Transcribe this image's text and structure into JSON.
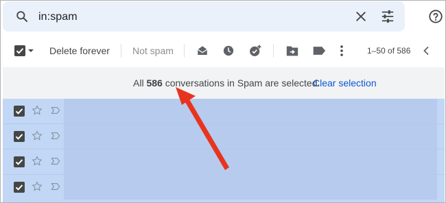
{
  "search": {
    "query": "in:spam",
    "search_icon": "search-icon",
    "clear_icon": "close-icon",
    "options_icon": "tune-icon"
  },
  "help_icon": "help-circle-icon",
  "toolbar": {
    "select_icon": "checkbox-checked-icon",
    "delete_forever_label": "Delete forever",
    "not_spam_label": "Not spam",
    "icons": [
      "mark-as-read-icon",
      "snooze-icon",
      "add-to-tasks-icon",
      "move-to-icon",
      "label-icon",
      "more-vert-icon"
    ],
    "pagination": "1–50 of 586",
    "prev_icon": "chevron-left-icon"
  },
  "banner": {
    "prefix": "All ",
    "count": "586",
    "suffix": " conversations in Spam are selected.",
    "clear_selection_label": "Clear selection"
  },
  "rows": [
    {
      "selected": true,
      "starred": false
    },
    {
      "selected": true,
      "starred": false
    },
    {
      "selected": true,
      "starred": false
    },
    {
      "selected": true,
      "starred": false
    }
  ],
  "colors": {
    "search_bg": "#eaf1fb",
    "banner_bg": "#f1f3f4",
    "selected_row_bg": "#c2d7f5",
    "link": "#0b57d0",
    "annotation_arrow": "#e8341f"
  }
}
